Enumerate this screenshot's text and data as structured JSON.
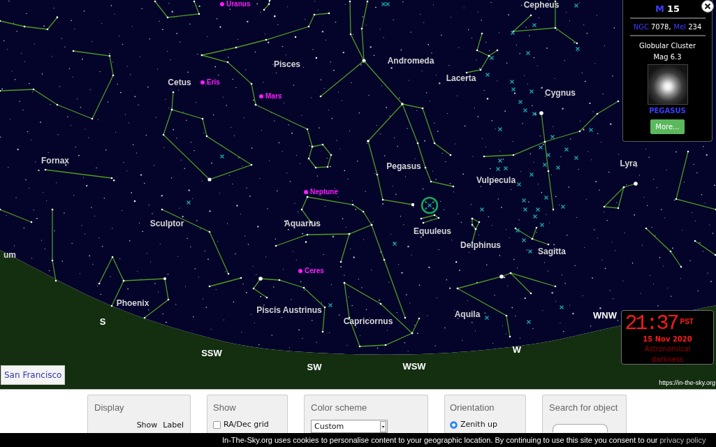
{
  "sky_map": {
    "constellation_labels": [
      "Cepheus",
      "Pisces",
      "Andromeda",
      "Cetus",
      "Lacerta",
      "Cygnus",
      "Fornax",
      "Pegasus",
      "Vulpecula",
      "Lyra",
      "Sculptor",
      "Aquarius",
      "Equuleus",
      "Delphinus",
      "Sagitta",
      "um",
      "Phoenix",
      "Piscis Austrinus",
      "Capricornus",
      "Aquila"
    ],
    "planets": [
      "Uranus",
      "Eris",
      "Mars",
      "Neptune",
      "Ceres"
    ],
    "compass_points": [
      "S",
      "SSW",
      "SW",
      "WSW",
      "W",
      "WNW"
    ],
    "location_button": "San Francisco",
    "credit": "https://in-the-sky.org"
  },
  "object_panel": {
    "catalog": "M",
    "number": "15",
    "designations": [
      {
        "catalog": "NGC",
        "number": "7078,"
      },
      {
        "catalog": "Mel",
        "number": "234"
      }
    ],
    "type": "Globular Cluster",
    "magnitude": "Mag 6.3",
    "constellation": "PEGASUS",
    "more_button": "More..."
  },
  "clock": {
    "time": "21:37",
    "zone": "PST",
    "date": "15 Nov 2020",
    "sky_state": "Astronomical darkness"
  },
  "controls": [
    {
      "kind": "columns",
      "title": "Display",
      "headers": [
        "Show",
        "Label"
      ]
    },
    {
      "kind": "checkbox",
      "title": "Show",
      "label": "RA/Dec grid",
      "checked": false
    },
    {
      "kind": "select",
      "title": "Color scheme",
      "value": "Custom"
    },
    {
      "kind": "radio",
      "title": "Orientation",
      "label": "Zenith up",
      "selected": true
    },
    {
      "kind": "search",
      "title": "Search for object"
    }
  ],
  "cookie_bar": {
    "text": "In-The-Sky.org uses cookies to personalise content to your geographic location. By continuing to use this site you consent to our",
    "link": "privacy policy"
  }
}
